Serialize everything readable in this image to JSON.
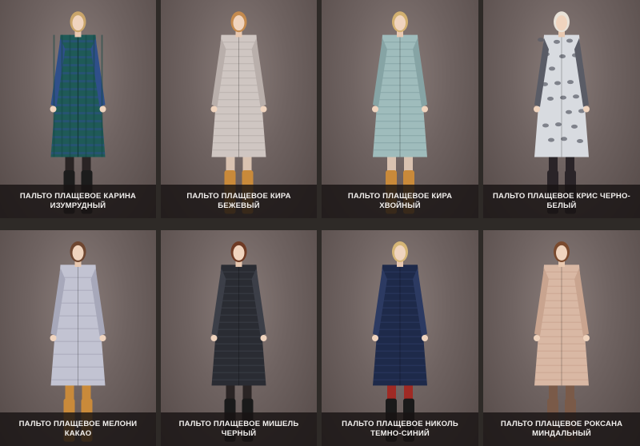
{
  "products": [
    {
      "title": "ПАЛЬТО ПЛАЩЕВОЕ КАРИНА ИЗУМРУДНЫЙ",
      "coat_color": "#1f5a57",
      "coat_accent": "#2f4f8a",
      "hair": "#c9a56a",
      "boots": "#1c1c1c",
      "legs": "#2a2424",
      "coat_style": "tweed"
    },
    {
      "title": "ПАЛЬТО ПЛАЩЕВОЕ КИРА БЕЖЕВЫЙ",
      "coat_color": "#cfc6c2",
      "coat_accent": "#b9afab",
      "hair": "#c48a4e",
      "boots": "#c98a3a",
      "legs": "#d9c2b0",
      "coat_style": "quilted"
    },
    {
      "title": "ПАЛЬТО ПЛАЩЕВОЕ КИРА ХВОЙНЫЙ",
      "coat_color": "#9fbcbc",
      "coat_accent": "#86a4a5",
      "hair": "#d2b070",
      "boots": "#c98a3a",
      "legs": "#d9c2b0",
      "coat_style": "quilted"
    },
    {
      "title": "ПАЛЬТО ПЛАЩЕВОЕ КРИС ЧЕРНО-БЕЛЫЙ",
      "coat_color": "#d8dbe0",
      "coat_accent": "#5a5c66",
      "hair": "#e8e2d8",
      "boots": "#2a2428",
      "legs": "#2a2428",
      "coat_style": "print"
    },
    {
      "title": "ПАЛЬТО ПЛАЩЕВОЕ МЕЛОНИ КАКАО",
      "coat_color": "#c2c3d2",
      "coat_accent": "#a7a8ba",
      "hair": "#6e4630",
      "boots": "#c98a3a",
      "legs": "#c98a3a",
      "coat_style": "puffer"
    },
    {
      "title": "ПАЛЬТО ПЛАЩЕВОЕ МИШЕЛЬ ЧЕРНЫЙ",
      "coat_color": "#2a2c33",
      "coat_accent": "#3c3f48",
      "hair": "#6e3a24",
      "boots": "#1a1a1a",
      "legs": "#2a2424",
      "coat_style": "quilted"
    },
    {
      "title": "ПАЛЬТО ПЛАЩЕВОЕ НИКОЛЬ ТЕМНО-СИНИЙ",
      "coat_color": "#1e2a4a",
      "coat_accent": "#2c3a62",
      "hair": "#d6b676",
      "boots": "#1a1a1a",
      "legs": "#a02a24",
      "coat_style": "quilted"
    },
    {
      "title": "ПАЛЬТО ПЛАЩЕВОЕ РОКСАНА МИНДАЛЬНЫЙ",
      "coat_color": "#d9b8a4",
      "coat_accent": "#c9a48f",
      "hair": "#7a4a2e",
      "boots": "#7a5a48",
      "legs": "#7a5a48",
      "coat_style": "quilted"
    }
  ]
}
